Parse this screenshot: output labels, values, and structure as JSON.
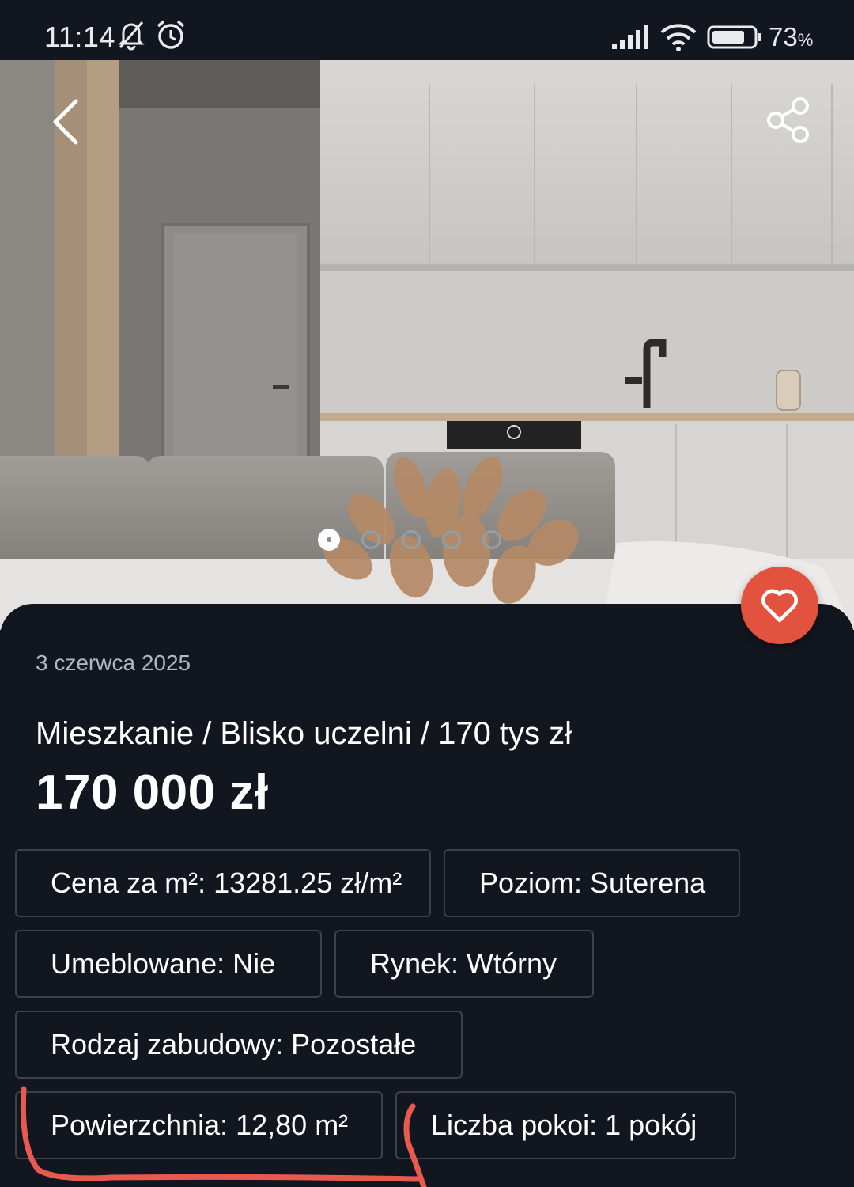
{
  "status_bar": {
    "time": "11:14",
    "battery_percent": "73",
    "battery_unit": "%",
    "icons": [
      "bell-off-icon",
      "alarm-icon",
      "signal-icon",
      "wifi-icon",
      "battery-icon"
    ]
  },
  "gallery": {
    "image_count": 5,
    "active_index": 0
  },
  "listing": {
    "date": "3 czerwca 2025",
    "title": "Mieszkanie / Blisko uczelni / 170 tys zł",
    "price": "170 000 zł",
    "attributes": [
      "Cena za m²: 13281.25 zł/m²",
      "Poziom: Suterena",
      "Umeblowane: Nie",
      "Rynek: Wtórny",
      "Rodzaj zabudowy: Pozostałe",
      "Powierzchnia: 12,80 m²",
      "Liczba pokoi: 1 pokój"
    ]
  },
  "colors": {
    "background": "#12161f",
    "accent_favorite": "#e2523f",
    "chip_border": "#3c414b",
    "annotation": "#e85a4f"
  }
}
